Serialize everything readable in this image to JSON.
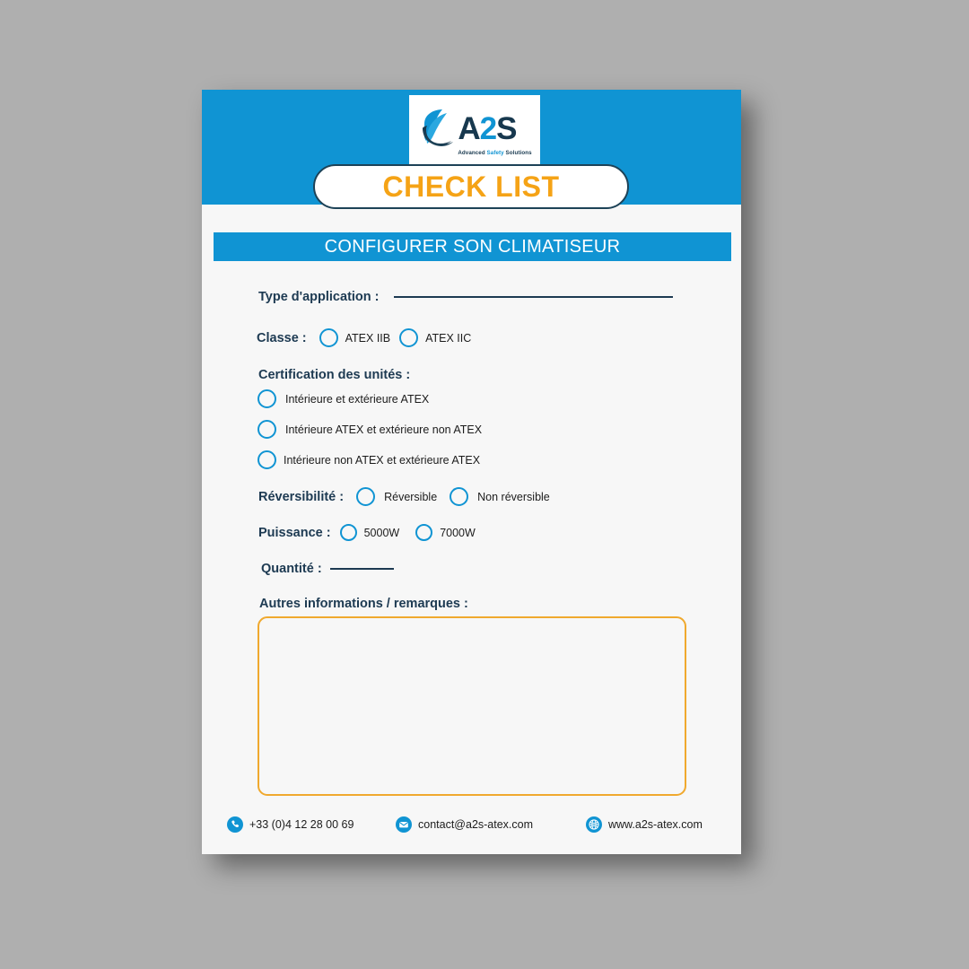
{
  "document": {
    "title": "CHECK LIST",
    "section_title": "CONFIGURER SON CLIMATISEUR"
  },
  "brand": {
    "logo_name": "A2S",
    "logo_letter_a": "A",
    "logo_digit_2": "2",
    "logo_letter_s": "S",
    "tagline_advanced": "Advanced ",
    "tagline_safety": "Safety ",
    "tagline_solutions": "Solutions",
    "colors": {
      "blue": "#1094d3",
      "navy": "#1d3a52",
      "orange": "#f5a316",
      "notes_border": "#f0a92e",
      "page_bg": "#f7f7f7",
      "canvas_bg": "#afafaf"
    }
  },
  "form": {
    "type_application": {
      "label": "Type d'application :",
      "value": ""
    },
    "classe": {
      "label": "Classe :",
      "options": [
        {
          "label": "ATEX IIB",
          "selected": false
        },
        {
          "label": "ATEX IIC",
          "selected": false
        }
      ]
    },
    "certification": {
      "label": "Certification des unités :",
      "options": [
        {
          "label": "Intérieure et extérieure ATEX",
          "selected": false
        },
        {
          "label": "Intérieure ATEX et extérieure non ATEX",
          "selected": false
        },
        {
          "label": "Intérieure non ATEX et extérieure ATEX",
          "selected": false
        }
      ]
    },
    "reversibilite": {
      "label": "Réversibilité :",
      "options": [
        {
          "label": "Réversible",
          "selected": false
        },
        {
          "label": "Non réversible",
          "selected": false
        }
      ]
    },
    "puissance": {
      "label": "Puissance :",
      "options": [
        {
          "label": "5000W",
          "selected": false
        },
        {
          "label": "7000W",
          "selected": false
        }
      ]
    },
    "quantite": {
      "label": "Quantité :",
      "value": ""
    },
    "autres": {
      "label": "Autres informations / remarques :",
      "value": "",
      "placeholder": ""
    }
  },
  "footer": {
    "phone": {
      "icon": "phone-icon",
      "text": "+33 (0)4 12 28 00 69"
    },
    "email": {
      "icon": "envelope-icon",
      "text": "contact@a2s-atex.com"
    },
    "website": {
      "icon": "globe-icon",
      "text": "www.a2s-atex.com"
    }
  }
}
